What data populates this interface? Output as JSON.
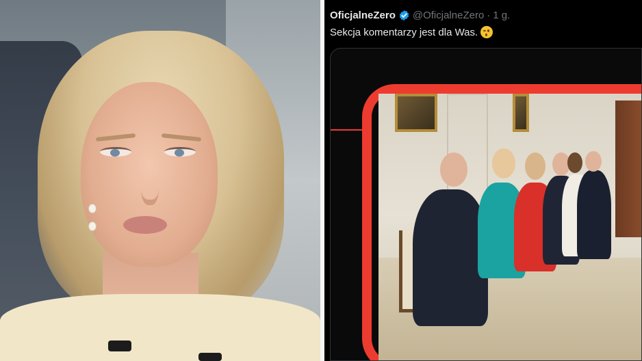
{
  "tweet": {
    "display_name": "OficjalneZero",
    "handle": "@OficjalneZero",
    "separator": "·",
    "time": "1 g.",
    "text": "Sekcja komentarzy jest dla Was.",
    "verified": true,
    "emoji": "wink-emoji"
  },
  "colors": {
    "background": "#000000",
    "text_primary": "#e7e9ea",
    "text_secondary": "#71767b",
    "verified_blue": "#1d9bf0",
    "frame_red": "#ee3b2f"
  }
}
